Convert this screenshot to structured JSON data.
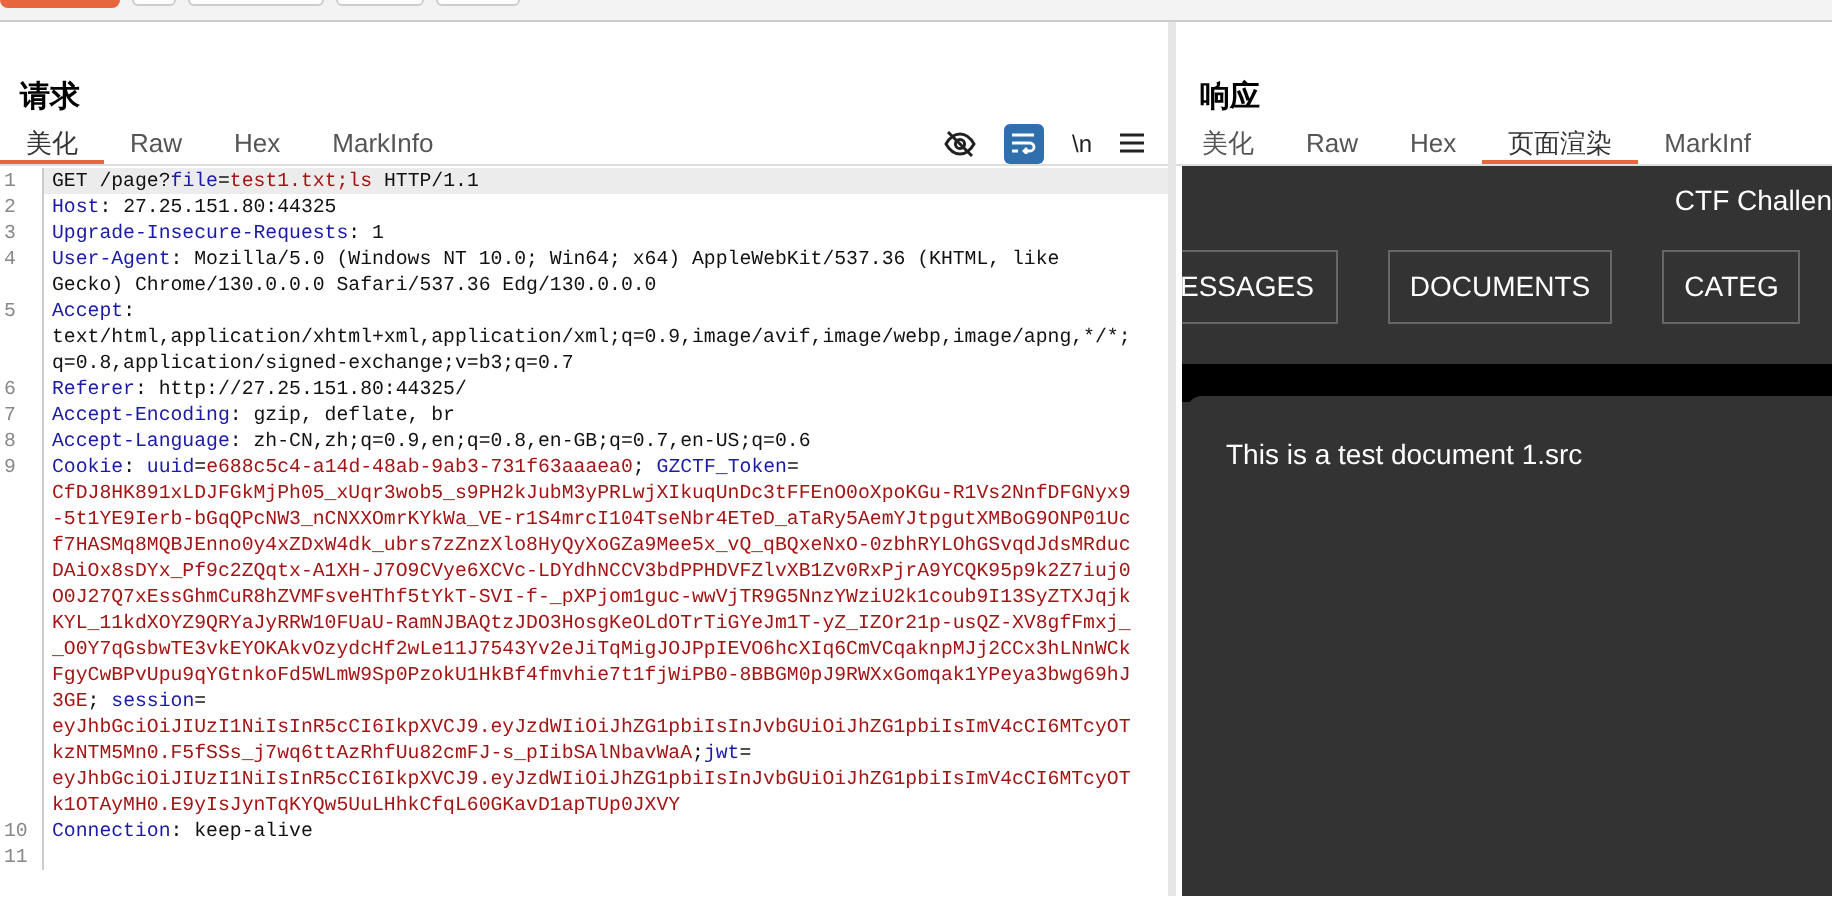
{
  "request": {
    "title": "请求",
    "tabs": [
      {
        "label": "美化",
        "selected": true
      },
      {
        "label": "Raw",
        "selected": false
      },
      {
        "label": "Hex",
        "selected": false
      },
      {
        "label": "MarkInfo",
        "selected": false
      }
    ],
    "tools": [
      {
        "kind": "hide"
      },
      {
        "kind": "wrap",
        "on": true
      },
      {
        "kind": "newline",
        "label": "\\n"
      },
      {
        "kind": "menu"
      }
    ],
    "lines": [
      {
        "number": "1",
        "current": true,
        "wrapped_rows": [
          {
            "segments": [
              {
                "kind": "plain",
                "text": "GET /page?"
              },
              {
                "kind": "name",
                "text": "file"
              },
              {
                "kind": "plain",
                "text": "="
              },
              {
                "kind": "value",
                "text": "test1.txt;ls"
              },
              {
                "kind": "plain",
                "text": " HTTP/1.1"
              }
            ]
          }
        ]
      },
      {
        "number": "2",
        "current": false,
        "wrapped_rows": [
          {
            "segments": [
              {
                "kind": "name",
                "text": "Host"
              },
              {
                "kind": "plain",
                "text": ": 27.25.151.80:44325"
              }
            ]
          }
        ]
      },
      {
        "number": "3",
        "current": false,
        "wrapped_rows": [
          {
            "segments": [
              {
                "kind": "name",
                "text": "Upgrade-Insecure-Requests"
              },
              {
                "kind": "plain",
                "text": ": 1"
              }
            ]
          }
        ]
      },
      {
        "number": "4",
        "current": false,
        "wrapped_rows": [
          {
            "segments": [
              {
                "kind": "name",
                "text": "User-Agent"
              },
              {
                "kind": "plain",
                "text": ": Mozilla/5.0 (Windows NT 10.0; Win64; x64) AppleWebKit/537.36 (KHTML, like"
              }
            ]
          },
          {
            "segments": [
              {
                "kind": "plain",
                "text": "Gecko) Chrome/130.0.0.0 Safari/537.36 Edg/130.0.0.0"
              }
            ]
          }
        ]
      },
      {
        "number": "5",
        "current": false,
        "wrapped_rows": [
          {
            "segments": [
              {
                "kind": "name",
                "text": "Accept"
              },
              {
                "kind": "plain",
                "text": ":"
              }
            ]
          },
          {
            "segments": [
              {
                "kind": "plain",
                "text": "text/html,application/xhtml+xml,application/xml;q=0.9,image/avif,image/webp,image/apng,*/*;"
              }
            ]
          },
          {
            "segments": [
              {
                "kind": "plain",
                "text": "q=0.8,application/signed-exchange;v=b3;q=0.7"
              }
            ]
          }
        ]
      },
      {
        "number": "6",
        "current": false,
        "wrapped_rows": [
          {
            "segments": [
              {
                "kind": "name",
                "text": "Referer"
              },
              {
                "kind": "plain",
                "text": ": http://27.25.151.80:44325/"
              }
            ]
          }
        ]
      },
      {
        "number": "7",
        "current": false,
        "wrapped_rows": [
          {
            "segments": [
              {
                "kind": "name",
                "text": "Accept-Encoding"
              },
              {
                "kind": "plain",
                "text": ": gzip, deflate, br"
              }
            ]
          }
        ]
      },
      {
        "number": "8",
        "current": false,
        "wrapped_rows": [
          {
            "segments": [
              {
                "kind": "name",
                "text": "Accept-Language"
              },
              {
                "kind": "plain",
                "text": ": zh-CN,zh;q=0.9,en;q=0.8,en-GB;q=0.7,en-US;q=0.6"
              }
            ]
          }
        ]
      },
      {
        "number": "9",
        "current": false,
        "wrapped_rows": [
          {
            "segments": [
              {
                "kind": "name",
                "text": "Cookie"
              },
              {
                "kind": "plain",
                "text": ": "
              },
              {
                "kind": "name",
                "text": "uuid"
              },
              {
                "kind": "plain",
                "text": "="
              },
              {
                "kind": "value",
                "text": "e688c5c4-a14d-48ab-9ab3-731f63aaaea0"
              },
              {
                "kind": "plain",
                "text": "; "
              },
              {
                "kind": "name",
                "text": "GZCTF_Token"
              },
              {
                "kind": "plain",
                "text": "="
              }
            ]
          },
          {
            "segments": [
              {
                "kind": "value",
                "text": "CfDJ8HK891xLDJFGkMjPh05_xUqr3wob5_s9PH2kJubM3yPRLwjXIkuqUnDc3tFFEnO0oXpoKGu-R1Vs2NnfDFGNyx9"
              }
            ]
          },
          {
            "segments": [
              {
                "kind": "value",
                "text": "-5t1YE9Ierb-bGqQPcNW3_nCNXXOmrKYkWa_VE-r1S4mrcI104TseNbr4ETeD_aTaRy5AemYJtpgutXMBoG9ONP01Uc"
              }
            ]
          },
          {
            "segments": [
              {
                "kind": "value",
                "text": "f7HASMq8MQBJEnno0y4xZDxW4dk_ubrs7zZnzXlo8HyQyXoGZa9Mee5x_vQ_qBQxeNxO-0zbhRYLOhGSvqdJdsMRduc"
              }
            ]
          },
          {
            "segments": [
              {
                "kind": "value",
                "text": "DAiOx8sDYx_Pf9c2ZQqtx-A1XH-J7O9CVye6XCVc-LDYdhNCCV3bdPPHDVFZlvXB1Zv0RxPjrA9YCQK95p9k2Z7iuj0"
              }
            ]
          },
          {
            "segments": [
              {
                "kind": "value",
                "text": "O0J27Q7xEssGhmCuR8hZVMFsveHThf5tYkT-SVI-f-_pXPjom1guc-wwVjTR9G5NnzYWziU2k1coub9I13SyZTXJqjk"
              }
            ]
          },
          {
            "segments": [
              {
                "kind": "value",
                "text": "KYL_11kdXOYZ9QRYaJyRRW10FUaU-RamNJBAQtzJDO3HosgKeOLdOTrTiGYeJm1T-yZ_IZOr21p-usQZ-XV8gfFmxj_"
              }
            ]
          },
          {
            "segments": [
              {
                "kind": "value",
                "text": "_O0Y7qGsbwTE3vkEYOKAkvOzydcHf2wLe11J7543Yv2eJiTqMigJOJPpIEVO6hcXIq6CmVCqaknpMJj2CCx3hLNnWCk"
              }
            ]
          },
          {
            "segments": [
              {
                "kind": "value",
                "text": "FgyCwBPvUpu9qYGtnkoFd5WLmW9Sp0PzokU1HkBf4fmvhie7t1fjWiPB0-8BBGM0pJ9RWXxGomqak1YPeya3bwg69hJ"
              }
            ]
          },
          {
            "segments": [
              {
                "kind": "value",
                "text": "3GE"
              },
              {
                "kind": "plain",
                "text": "; "
              },
              {
                "kind": "name",
                "text": "session"
              },
              {
                "kind": "plain",
                "text": "="
              }
            ]
          },
          {
            "segments": [
              {
                "kind": "value",
                "text": "eyJhbGciOiJIUzI1NiIsInR5cCI6IkpXVCJ9.eyJzdWIiOiJhZG1pbiIsInJvbGUiOiJhZG1pbiIsImV4cCI6MTcyOT"
              }
            ]
          },
          {
            "segments": [
              {
                "kind": "value",
                "text": "kzNTM5Mn0.F5fSSs_j7wq6ttAzRhfUu82cmFJ-s_pIibSAlNbavWaA"
              },
              {
                "kind": "plain",
                "text": ";"
              },
              {
                "kind": "name",
                "text": "jwt"
              },
              {
                "kind": "plain",
                "text": "="
              }
            ]
          },
          {
            "segments": [
              {
                "kind": "value",
                "text": "eyJhbGciOiJIUzI1NiIsInR5cCI6IkpXVCJ9.eyJzdWIiOiJhZG1pbiIsInJvbGUiOiJhZG1pbiIsImV4cCI6MTcyOT"
              }
            ]
          },
          {
            "segments": [
              {
                "kind": "value",
                "text": "k1OTAyMH0.E9yIsJynTqKYQw5UuLHhkCfqL60GKavD1apTUp0JXVY"
              }
            ]
          }
        ]
      },
      {
        "number": "10",
        "current": false,
        "wrapped_rows": [
          {
            "segments": [
              {
                "kind": "name",
                "text": "Connection"
              },
              {
                "kind": "plain",
                "text": ": keep-alive"
              }
            ]
          }
        ]
      },
      {
        "number": "11",
        "current": false,
        "wrapped_rows": [
          {
            "segments": []
          }
        ]
      }
    ]
  },
  "response": {
    "title": "响应",
    "tabs": [
      {
        "label": "美化",
        "selected": false
      },
      {
        "label": "Raw",
        "selected": false
      },
      {
        "label": "Hex",
        "selected": false
      },
      {
        "label": "页面渲染",
        "selected": true
      },
      {
        "label": "MarkInf",
        "selected": false
      }
    ],
    "render": {
      "site_title": "CTF Challen",
      "nav": [
        "ESSAGES",
        "DOCUMENTS",
        "CATEG"
      ],
      "document_text": "This is a test document 1.src"
    }
  }
}
